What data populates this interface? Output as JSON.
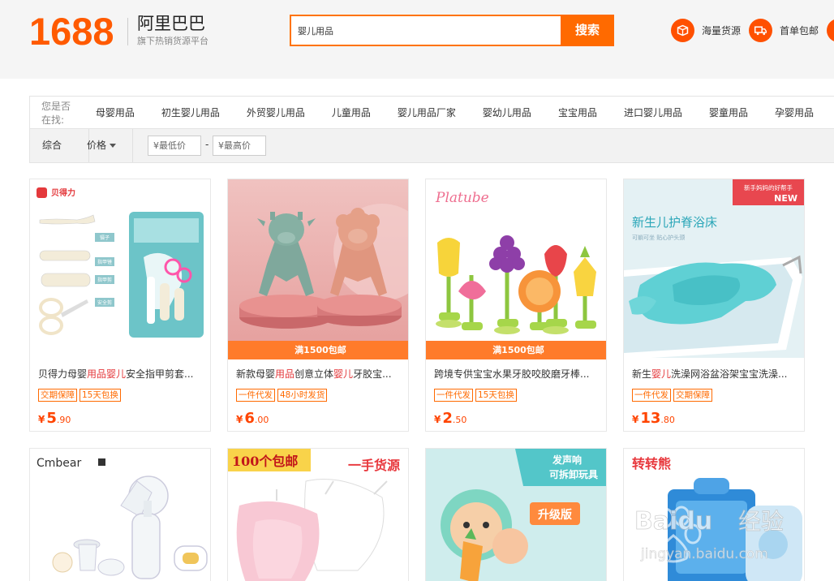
{
  "header": {
    "logo_number": "1688",
    "logo_name": "阿里巴巴",
    "logo_sub": "旗下热销货源平台",
    "search_value": "婴儿用品",
    "search_button": "搜索",
    "links": [
      {
        "label": "海量货源",
        "icon": "box-icon"
      },
      {
        "label": "首单包邮",
        "icon": "truck-icon"
      }
    ]
  },
  "suggest": {
    "label": "您是否在找:",
    "items": [
      "母婴用品",
      "初生婴儿用品",
      "外贸婴儿用品",
      "儿童用品",
      "婴儿用品厂家",
      "婴幼儿用品",
      "宝宝用品",
      "进口婴儿用品",
      "婴童用品",
      "孕婴用品"
    ]
  },
  "filter": {
    "tab_all": "综合",
    "tab_price": "价格",
    "min_price_placeholder": "¥最低价",
    "max_price_placeholder": "¥最高价",
    "dash": "-"
  },
  "products": [
    {
      "title_pre": "贝得力母婴",
      "title_hl1": "用品",
      "title_mid": "",
      "title_hl2": "婴儿",
      "title_post": "安全指甲剪套...",
      "tags": [
        "交期保障",
        "15天包换"
      ],
      "currency": "¥",
      "price_int": "5",
      "price_dec": ".90",
      "promo": "",
      "brand": "贝得力",
      "img_labels": [
        "镊子",
        "指甲锉",
        "指甲剪",
        "安全剪"
      ]
    },
    {
      "title_pre": "新款母婴",
      "title_hl1": "用品",
      "title_mid": "创意立体",
      "title_hl2": "婴儿",
      "title_post": "牙胶宝...",
      "tags": [
        "一件代发",
        "48小时发货"
      ],
      "currency": "¥",
      "price_int": "6",
      "price_dec": ".00",
      "promo": "满1500包邮"
    },
    {
      "title_pre": "跨境专供宝宝水果牙胶咬胶磨牙棒...",
      "title_hl1": "",
      "title_mid": "",
      "title_hl2": "",
      "title_post": "",
      "tags": [
        "一件代发",
        "15天包换"
      ],
      "currency": "¥",
      "price_int": "2",
      "price_dec": ".50",
      "promo": "满1500包邮",
      "brand": "Platube"
    },
    {
      "title_pre": "新生",
      "title_hl1": "婴儿",
      "title_mid": "洗澡网浴盆浴架宝宝洗澡...",
      "title_hl2": "",
      "title_post": "",
      "tags": [
        "一件代发",
        "交期保障"
      ],
      "currency": "¥",
      "price_int": "13",
      "price_dec": ".80",
      "promo": "",
      "badge_top": "新手妈妈的好帮手",
      "badge_new": "NEW",
      "img_title": "新生儿护脊浴床",
      "img_sub": "可躺可坐 贴心护头颈"
    }
  ],
  "row2": [
    {
      "brand": "Cmbear"
    },
    {
      "banner1": "100个包邮",
      "banner2": "一手货源"
    },
    {
      "banner1": "发声响",
      "banner2": "可拆卸玩具",
      "badge": "升级版"
    },
    {
      "brand": "转转熊"
    }
  ],
  "watermark": {
    "text1": "Baidu",
    "text2": "经验",
    "text3": "jingyan.baidu.com"
  },
  "colors": {
    "brand": "#ff6a00",
    "price": "#ff4400",
    "highlight": "#e4393c"
  }
}
